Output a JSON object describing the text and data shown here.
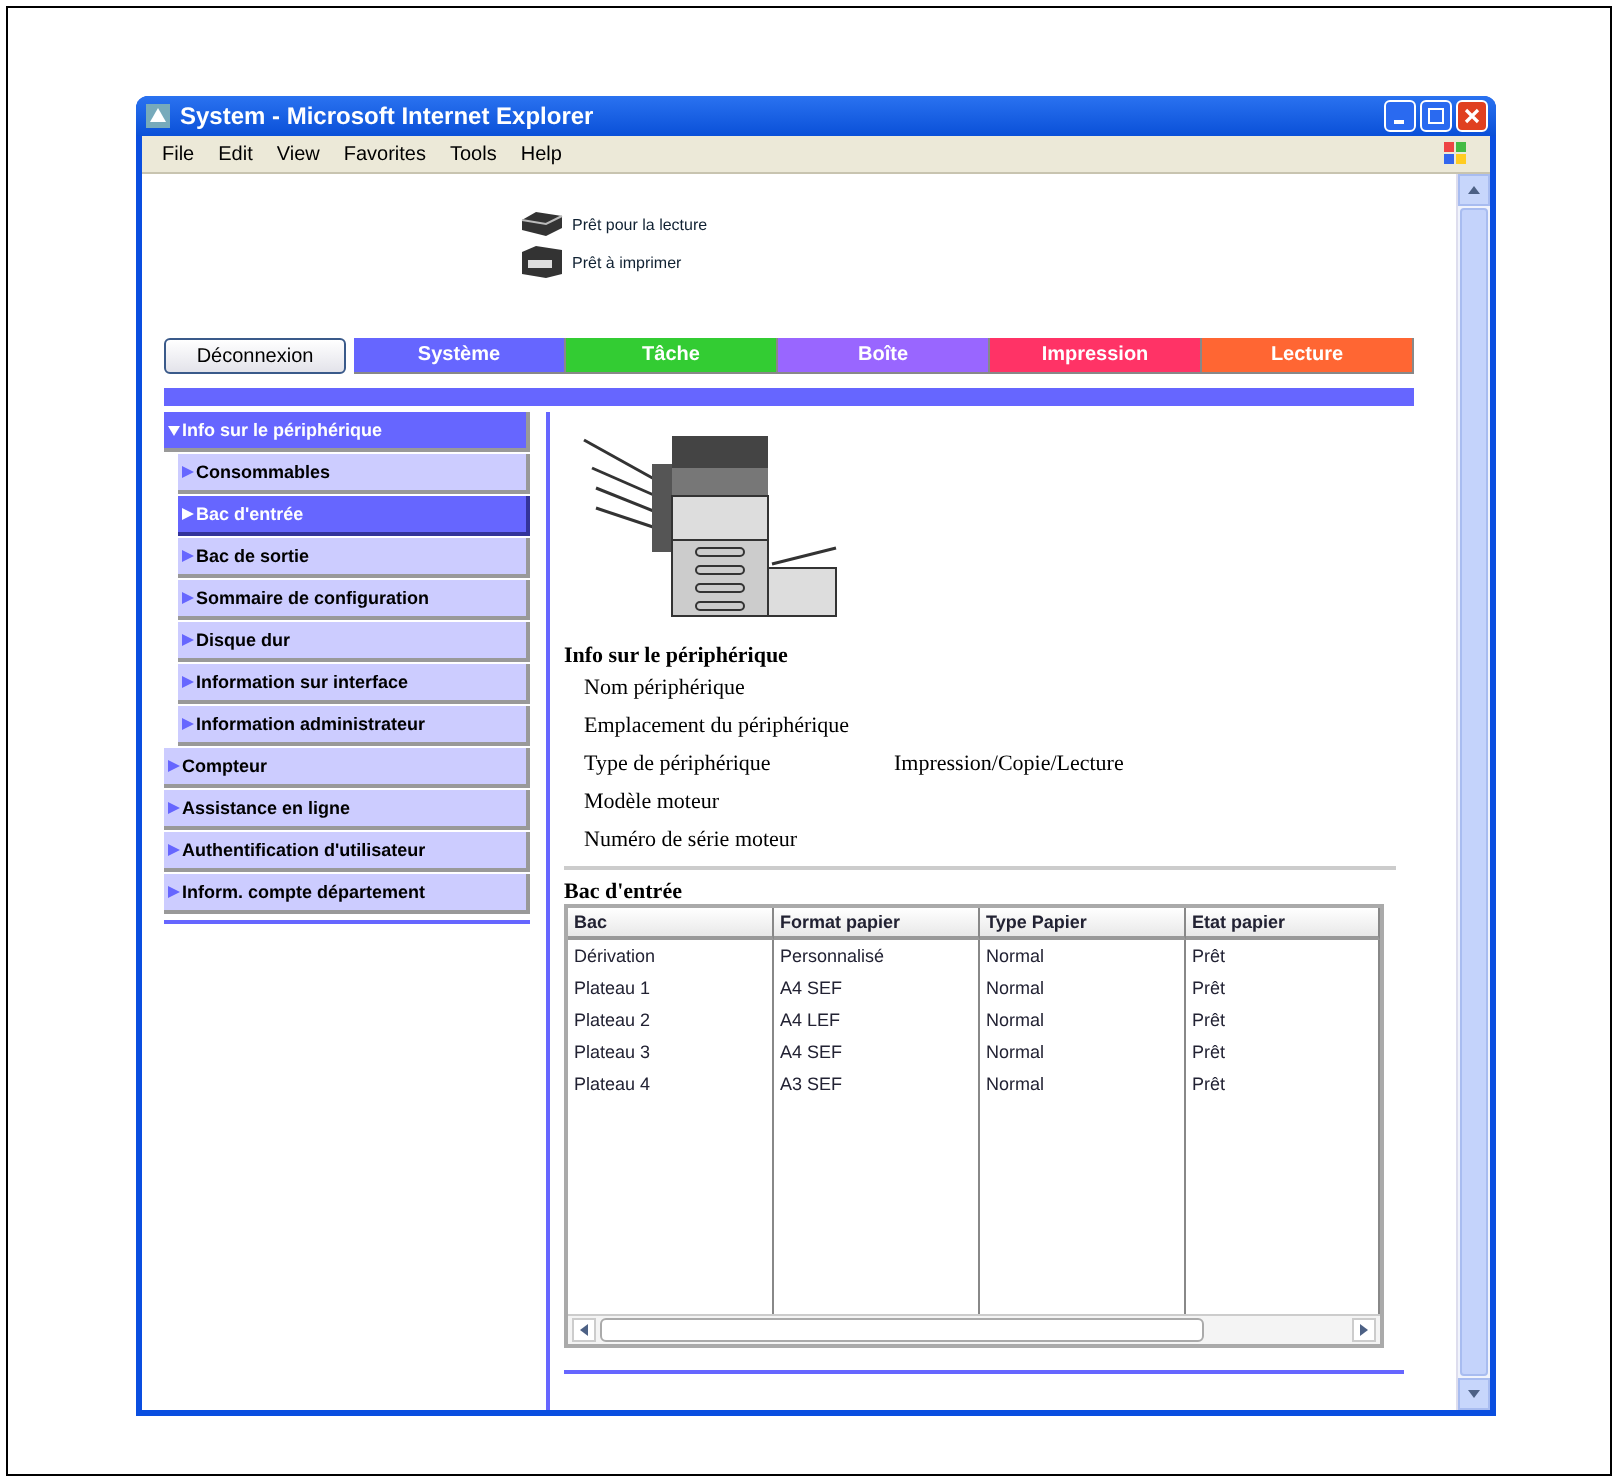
{
  "window": {
    "title": "System - Microsoft Internet Explorer"
  },
  "menu": [
    "File",
    "Edit",
    "View",
    "Favorites",
    "Tools",
    "Help"
  ],
  "status": [
    {
      "kind": "scanner",
      "label": "Prêt pour la lecture"
    },
    {
      "kind": "printer",
      "label": "Prêt à imprimer"
    }
  ],
  "logout_button": "Déconnexion",
  "tabs": [
    {
      "label": "Système",
      "color": "#6666ff"
    },
    {
      "label": "Tâche",
      "color": "#33cc33"
    },
    {
      "label": "Boîte",
      "color": "#9966ff"
    },
    {
      "label": "Impression",
      "color": "#ff3366"
    },
    {
      "label": "Lecture",
      "color": "#ff6633"
    }
  ],
  "sidebar": {
    "items": [
      {
        "label": "Info sur le périphérique",
        "selected": false,
        "expanded": true,
        "children": [
          {
            "label": "Consommables",
            "selected": false
          },
          {
            "label": "Bac d'entrée",
            "selected": true
          },
          {
            "label": "Bac de sortie",
            "selected": false
          },
          {
            "label": "Sommaire de configuration",
            "selected": false
          },
          {
            "label": "Disque dur",
            "selected": false
          },
          {
            "label": "Information sur interface",
            "selected": false
          },
          {
            "label": "Information administrateur",
            "selected": false
          }
        ]
      },
      {
        "label": "Compteur",
        "selected": false,
        "expanded": false
      },
      {
        "label": "Assistance en ligne",
        "selected": false,
        "expanded": false
      },
      {
        "label": "Authentification d'utilisateur",
        "selected": false,
        "expanded": false
      },
      {
        "label": "Inform. compte département",
        "selected": false,
        "expanded": false
      }
    ]
  },
  "device_info": {
    "title": "Info sur le périphérique",
    "rows": [
      {
        "label": "Nom périphérique"
      },
      {
        "label": "Emplacement du périphérique"
      },
      {
        "label": "Type de périphérique",
        "value": "Impression/Copie/Lecture"
      },
      {
        "label": "Modèle moteur"
      },
      {
        "label": "Numéro de série moteur"
      }
    ]
  },
  "tray_table": {
    "title": "Bac d'entrée",
    "columns": [
      "Bac",
      "Format papier",
      "Type Papier",
      "Etat papier"
    ],
    "rows": [
      [
        "Dérivation",
        "Personnalisé",
        "Normal",
        "Prêt"
      ],
      [
        "Plateau 1",
        "A4 SEF",
        "Normal",
        "Prêt"
      ],
      [
        "Plateau 2",
        "A4 LEF",
        "Normal",
        "Prêt"
      ],
      [
        "Plateau 3",
        "A4 SEF",
        "Normal",
        "Prêt"
      ],
      [
        "Plateau 4",
        "A3 SEF",
        "Normal",
        "Prêt"
      ]
    ]
  }
}
